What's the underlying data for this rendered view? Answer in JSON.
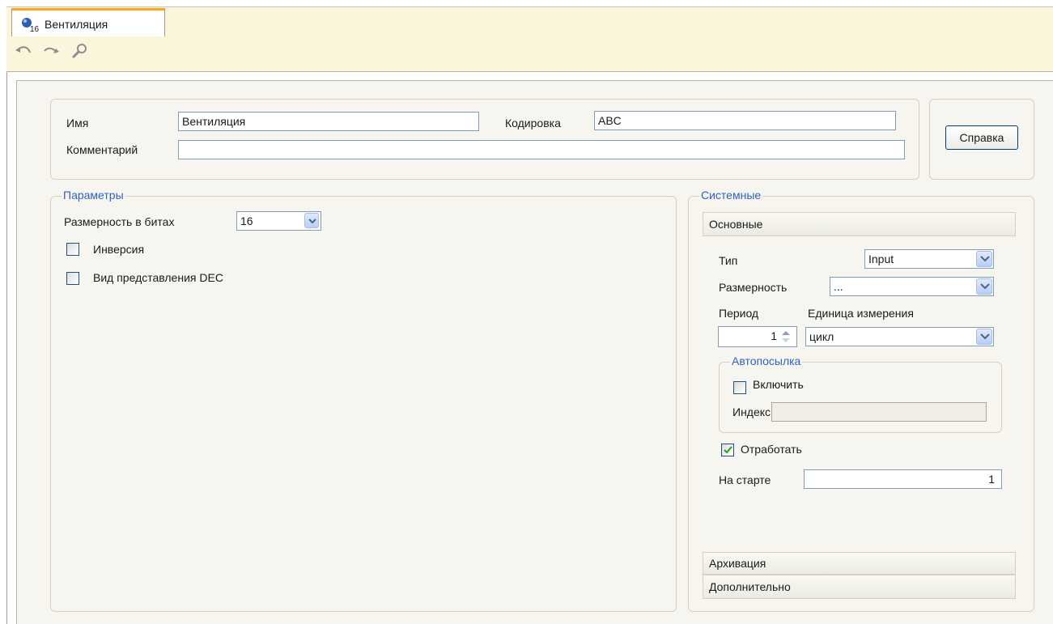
{
  "tab": {
    "title": "Вентиляция",
    "icon": "tag-bullet-icon",
    "badge": "16"
  },
  "toolbar": {
    "undo_icon": "undo-icon",
    "redo_icon": "redo-icon",
    "tool_icon": "wrench-icon"
  },
  "header": {
    "name_label": "Имя",
    "name_value": "Вентиляция",
    "encoding_label": "Кодировка",
    "encoding_value": "ABC",
    "comment_label": "Комментарий",
    "comment_value": "",
    "help_button": "Справка"
  },
  "params": {
    "legend": "Параметры",
    "bits_label": "Размерность в битах",
    "bits_value": "16",
    "inversion_label": "Инверсия",
    "inversion_checked": false,
    "dec_label": "Вид представления DEC",
    "dec_checked": false
  },
  "system": {
    "legend": "Системные",
    "main_section": "Основные",
    "type_label": "Тип",
    "type_value": "Input",
    "dimension_label": "Размерность",
    "dimension_value": "...",
    "period_label": "Период",
    "unit_label": "Единица измерения",
    "period_value": "1",
    "unit_value": "цикл",
    "autosend": {
      "legend": "Автопосылка",
      "enable_label": "Включить",
      "enable_checked": false,
      "index_label": "Индекс",
      "index_value": ""
    },
    "process_label": "Отработать",
    "process_checked": true,
    "start_label": "На старте",
    "start_value": "1",
    "archive_section": "Архивация",
    "extra_section": "Дополнительно"
  },
  "colors": {
    "accent": "#2f62c7",
    "tab_highlight": "#f3a81f",
    "chrome": "#fbf5dc",
    "panel": "#f7f5ef"
  }
}
